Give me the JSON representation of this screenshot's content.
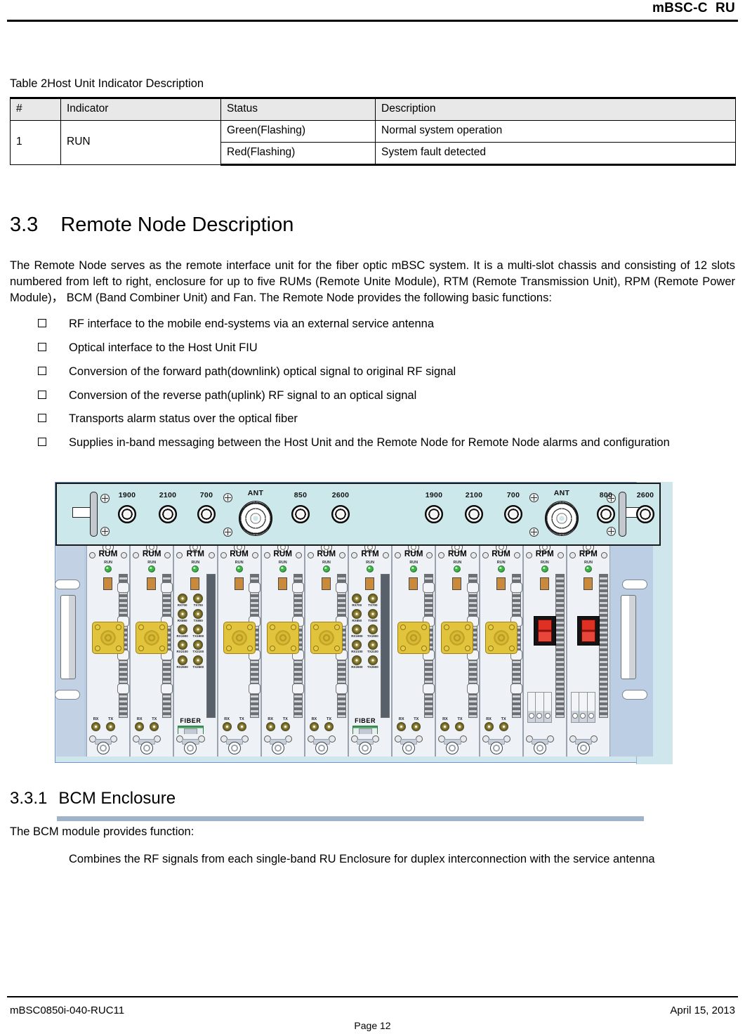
{
  "header": {
    "title": "mBSC-C  RU"
  },
  "table": {
    "caption": "Table 2Host Unit Indicator Description",
    "columns": [
      "#",
      "Indicator",
      "Status",
      "Description"
    ],
    "rows": [
      {
        "num": "1",
        "indicator": "RUN",
        "states": [
          {
            "status": "Green(Flashing)",
            "description": "Normal system operation"
          },
          {
            "status": "Red(Flashing)",
            "description": "System fault detected"
          }
        ]
      }
    ]
  },
  "section": {
    "number": "3.3",
    "title": "Remote Node Description",
    "intro": "The Remote Node serves as the remote interface unit for the fiber optic mBSC system. It is a multi-slot chassis and consisting of 12 slots numbered from left to right, enclosure for up to five RUMs (Remote Unite Module), RTM (Remote Transmission Unit), RPM (Remote Power Module)，  BCM (Band Combiner Unit) and Fan. The Remote Node provides the following basic functions:",
    "bullets": [
      "RF interface to the mobile end-systems via an external service antenna",
      "Optical interface to the Host Unit FIU",
      "Conversion of the forward path(downlink) optical signal to original RF signal",
      "Conversion of the reverse path(uplink) RF signal to an optical signal",
      "Transports alarm status over the optical fiber",
      "Supplies in-band messaging between the Host Unit and the Remote Node for Remote Node alarms and configuration"
    ]
  },
  "subsection": {
    "number": "3.3.1",
    "title": "BCM Enclosure",
    "lead": "The BCM module provides function:",
    "body": "Combines the RF signals from each single-band RU Enclosure for duplex interconnection with the service antenna"
  },
  "diagram": {
    "name": "remote-node-chassis-front-view",
    "top_panel": {
      "left_group": [
        "1900",
        "2100",
        "700"
      ],
      "left_antenna": "ANT",
      "left_group2": [
        "850",
        "2600"
      ],
      "right_group": [
        "1900",
        "2100",
        "700"
      ],
      "right_antenna": "ANT",
      "right_group2": [
        "800",
        "2600"
      ]
    },
    "slots": [
      {
        "type": "RUM",
        "led": "RUN"
      },
      {
        "type": "RUM",
        "led": "RUN"
      },
      {
        "type": "RTM",
        "led": "RUN"
      },
      {
        "type": "RUM",
        "led": "RUN"
      },
      {
        "type": "RUM",
        "led": "RUN"
      },
      {
        "type": "RUM",
        "led": "RUN"
      },
      {
        "type": "RTM",
        "led": "RUN"
      },
      {
        "type": "RUM",
        "led": "RUN"
      },
      {
        "type": "RUM",
        "led": "RUN"
      },
      {
        "type": "RUM",
        "led": "RUN"
      },
      {
        "type": "RPM",
        "led": "RUN"
      },
      {
        "type": "RPM",
        "led": "RUN"
      }
    ],
    "rtm_ports": [
      "RX700",
      "TX700",
      "RX850",
      "TX850",
      "RX1900",
      "TX1900",
      "RX2100",
      "TX2100",
      "RX2600",
      "TX2600"
    ],
    "rtm_fiber_label": "FIBER",
    "rum_ports": [
      "RX",
      "TX"
    ],
    "colors": {
      "panel_cyan": "#cce8ea",
      "chassis_blue": "#b9cbe0",
      "card_face": "#eef1f6",
      "led_green": "#3cb44a",
      "switch_red": "#e03024",
      "n_connector_gold": "#e2c43c",
      "fiber_green": "#3c9a55"
    }
  },
  "footer": {
    "left": "mBSC0850i-040-RUC11",
    "right": "April 15, 2013",
    "center": "Page 12"
  }
}
